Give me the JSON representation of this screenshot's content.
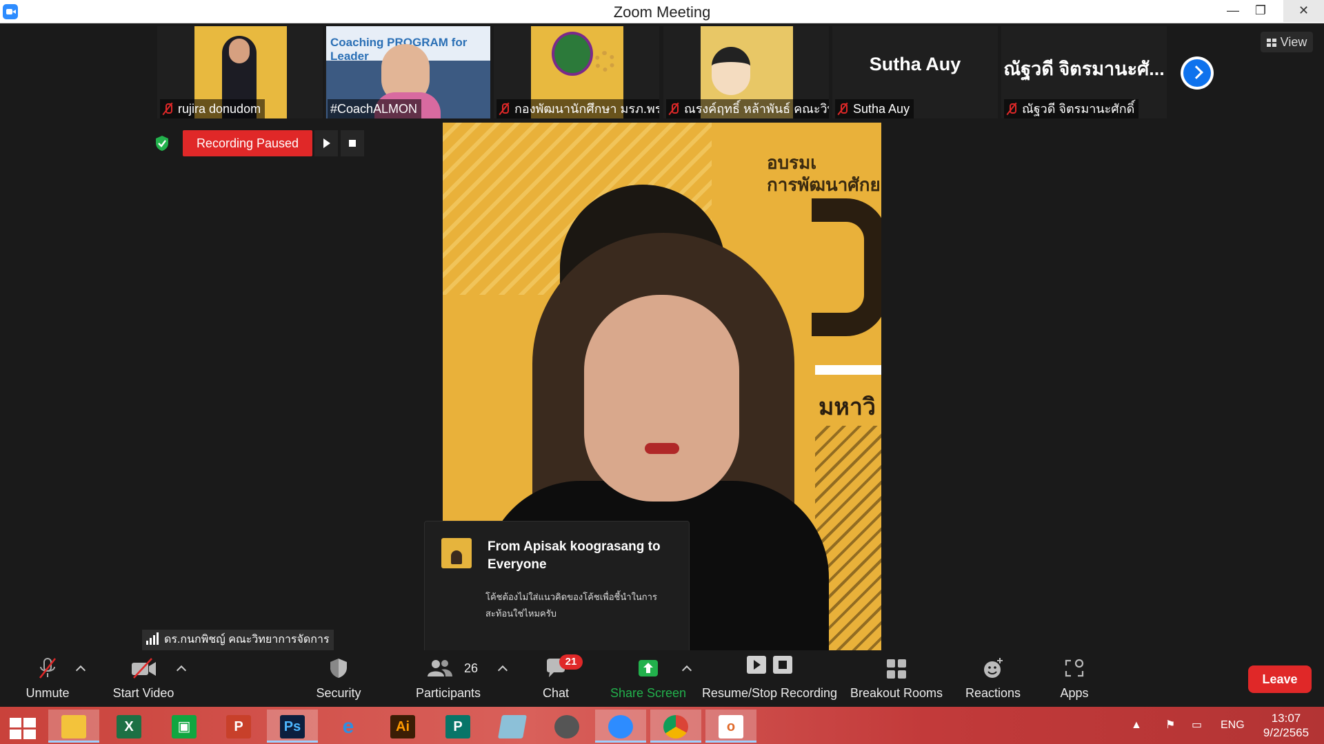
{
  "window": {
    "title": "Zoom Meeting",
    "minimize": "—",
    "restore": "❐",
    "close": "✕"
  },
  "thumbnails": [
    {
      "name": "rujira donudom",
      "muted": true
    },
    {
      "name": "#CoachALMON",
      "muted": false
    },
    {
      "name": "กองพัฒนานักศึกษา มรภ.พร...",
      "muted": true
    },
    {
      "name": "ณรงค์ฤทธิ์ หล้าพันธ์ คณะวิทย์",
      "muted": true
    },
    {
      "name": "Sutha Auy",
      "tile_text": "Sutha Auy",
      "muted": true
    },
    {
      "name": "ณัฐวดี จิตรมานะศักดิ์",
      "tile_text": "ณัฐวดี จิตรมานะศั...",
      "muted": true
    }
  ],
  "thumb_overlay_text": "Coaching PROGRAM for Leader",
  "view_button": "View",
  "recording": {
    "status": "Recording Paused"
  },
  "main_video": {
    "banner_line1": "อบรมเ",
    "banner_line2": "การพัฒนาศักย",
    "banner_line3": "มหาวิ"
  },
  "chat_notification": {
    "from": "From Apisak koograsang to Everyone",
    "message": "โค้ชต้องไม่ใส่แนวคิดของโค้ชเพื่อชี้นำในการสะท้อนใช่ไหมครับ"
  },
  "active_speaker": "ดร.กนกพิชญ์ คณะวิทยาการจัดการ",
  "toolbar": {
    "unmute": "Unmute",
    "start_video": "Start Video",
    "security": "Security",
    "participants": "Participants",
    "participants_count": "26",
    "chat": "Chat",
    "chat_badge": "21",
    "share_screen": "Share Screen",
    "recording": "Resume/Stop Recording",
    "breakout_rooms": "Breakout Rooms",
    "reactions": "Reactions",
    "apps": "Apps",
    "leave": "Leave"
  },
  "taskbar": {
    "apps": [
      "Windows",
      "File Explorer",
      "Excel",
      "Store",
      "PowerPoint",
      "Photoshop",
      "Internet Explorer",
      "Illustrator",
      "Publisher",
      "App",
      "PhotoScape",
      "Zoom",
      "Chrome",
      "Office"
    ],
    "language": "ENG",
    "time": "13:07",
    "date": "9/2/2565"
  },
  "colors": {
    "accent": "#0e72ed",
    "danger": "#e02828",
    "share": "#22b14c"
  }
}
